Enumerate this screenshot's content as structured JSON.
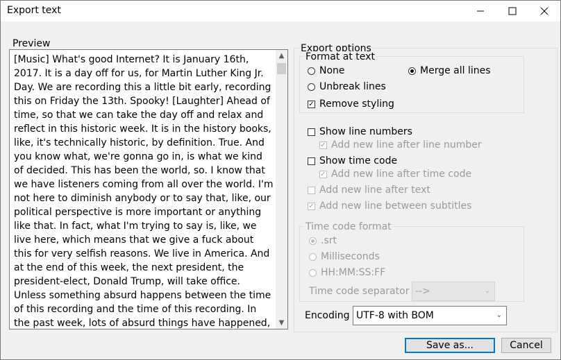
{
  "window": {
    "title": "Export text"
  },
  "preview": {
    "label": "Preview",
    "text": "[Music] What's good Internet? It is January 16th, 2017. It is a day off for us, for Martin Luther King Jr. Day. We are recording this a little bit early, recording this on Friday the 13th. Spooky! [Laughter] Ahead of time, so that we can take the day off and relax and reflect in this historic week. It is in the history books, like, it's technically historic, by definition. True. And you know what, we're gonna go in, is what we kind of decided. This has been the world, so. I know that we have listeners coming from all over the world. I'm not here to diminish anybody or to say that, like, our political perspective is more important or anything like that. In fact, what I'm trying to say is, like, we live here, which means that we give a fuck about this for very selfish reasons. We live in America. And at the end of this week, the next president, the president-elect, Donald Trump, will take office. Unless something absurd happens between the time of this recording and the time of this recording. In the past week, lots of absurd things have happened, so, you know, don't count it out. It's true. Who knows? More"
  },
  "export_options": {
    "label": "Export options",
    "format_text": {
      "label": "Format at text",
      "none": "None",
      "merge_all_lines": "Merge all lines",
      "unbreak_lines": "Unbreak lines",
      "remove_styling": "Remove styling",
      "selected": "merge_all_lines",
      "remove_styling_checked": true
    },
    "show_line_numbers": "Show line numbers",
    "add_new_line_after_line_number": "Add new line after line number",
    "show_time_code": "Show time code",
    "add_new_line_after_time_code": "Add new line after time code",
    "add_new_line_after_text": "Add new line after text",
    "add_new_line_between_subtitles": "Add new line between subtitles",
    "time_code_format": {
      "label": "Time code format",
      "srt": ".srt",
      "milliseconds": "Milliseconds",
      "hhmmssff": "HH:MM:SS:FF",
      "separator_label": "Time code separator",
      "separator_value": "-->"
    },
    "encoding": {
      "label": "Encoding",
      "value": "UTF-8 with BOM"
    }
  },
  "buttons": {
    "save_as": "Save as...",
    "cancel": "Cancel"
  },
  "icons": {
    "minimize": "minimize-icon",
    "maximize": "maximize-icon",
    "close": "close-icon",
    "check": "checkmark-icon"
  }
}
